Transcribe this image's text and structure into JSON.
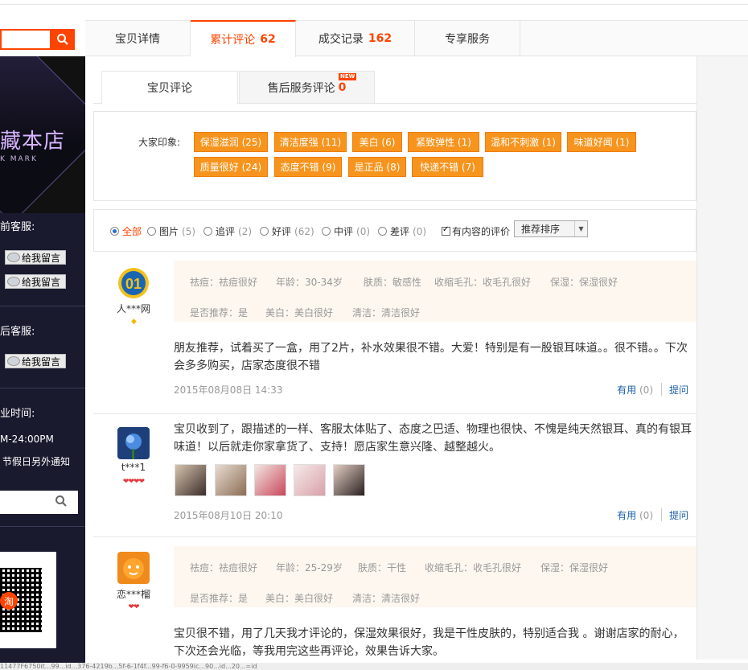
{
  "main_tabs": [
    {
      "label": "宝贝详情",
      "count": ""
    },
    {
      "label": "累计评论",
      "count": "62"
    },
    {
      "label": "成交记录",
      "count": "162"
    },
    {
      "label": "专享服务",
      "count": ""
    }
  ],
  "sidebar": {
    "logo_text": "藏本店",
    "logo_sub": "K MARK",
    "presale_label": "前客服:",
    "aftersale_label": "后客服:",
    "leave_msg": "给我留言",
    "hours_label": "业时间:",
    "hours": "M-24:00PM",
    "holiday": "节假日另外通知",
    "qr_logo": "淘"
  },
  "sub_tabs": [
    {
      "label": "宝贝评论",
      "count": ""
    },
    {
      "label": "售后服务评论",
      "count": "0",
      "badge": "NEW"
    }
  ],
  "impression": {
    "label": "大家印象:",
    "tags": [
      "保湿滋润 (25)",
      "清洁度强 (11)",
      "美白 (6)",
      "紧致弹性 (1)",
      "温和不刺激 (1)",
      "味道好闻 (1)",
      "质量很好 (24)",
      "态度不错 (9)",
      "是正品 (8)",
      "快递不错 (7)"
    ]
  },
  "filter": {
    "options": [
      {
        "label": "全部",
        "count": ""
      },
      {
        "label": "图片",
        "count": "(5)"
      },
      {
        "label": "追评",
        "count": "(2)"
      },
      {
        "label": "好评",
        "count": "(62)"
      },
      {
        "label": "中评",
        "count": "(0)"
      },
      {
        "label": "差评",
        "count": "(0)"
      }
    ],
    "has_content": "有内容的评价",
    "sort": "推荐排序"
  },
  "reviews": [
    {
      "user": "人***网",
      "attrs": [
        "祛痘：祛痘很好",
        "年龄：30-34岁",
        "肤质：敏感性",
        "收缩毛孔：收毛孔很好",
        "保湿：保湿很好",
        "是否推荐：是",
        "美白：美白很好",
        "清洁：清洁很好"
      ],
      "content": "朋友推荐，试着买了一盒，用了2片，补水效果很不错。大爱！特别是有一股银耳味道。。很不错。。下次会多多购买，店家态度很不错",
      "date": "2015年08月08日 14:33",
      "useful": "有用",
      "useful_count": "(0)",
      "ask": "提问"
    },
    {
      "user": "t***1",
      "attrs": [],
      "content": "宝贝收到了，跟描述的一样、客服太体贴了、态度之巴适、物理也很快、不愧是纯天然银耳、真的有银耳味道！以后就走你家拿货了、支持！愿店家生意兴隆、越整越火。",
      "date": "2015年08月10日 20:10",
      "useful": "有用",
      "useful_count": "(0)",
      "ask": "提问"
    },
    {
      "user": "恋***榴",
      "attrs": [
        "祛痘：祛痘很好",
        "年龄：25-29岁",
        "肤质：干性",
        "收缩毛孔：收毛孔很好",
        "保湿：保湿很好",
        "是否推荐：是",
        "美白：美白很好",
        "清洁：清洁很好"
      ],
      "content": "宝贝很不错，用了几天我才评论的，保湿效果很好，我是干性皮肤的，特别适合我 。谢谢店家的耐心，下次还会光临，等我用完这些再评论，效果告诉大家。",
      "date": "",
      "useful": "",
      "useful_count": "",
      "ask": ""
    }
  ],
  "status_text": "11477F6750it...99...id...376-4219b...5f-6-1f4f...99-f6-0-9959ic...90...id...20...=id"
}
